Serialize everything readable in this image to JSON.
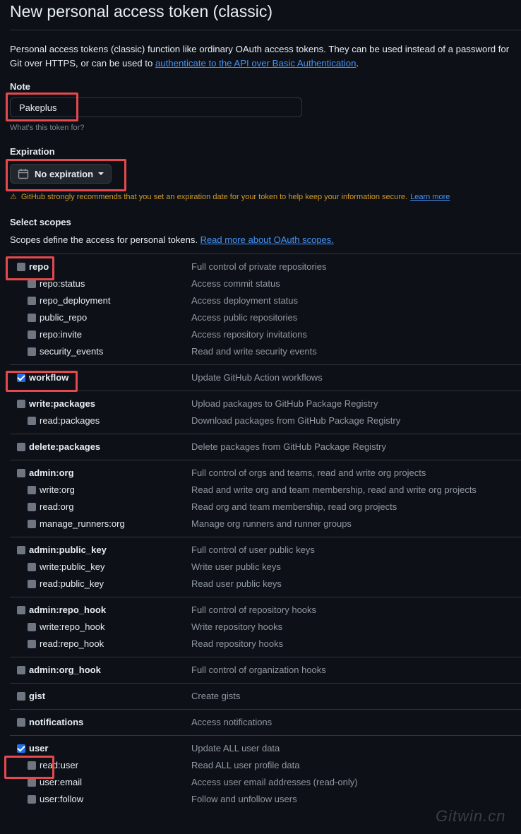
{
  "page": {
    "title": "New personal access token (classic)",
    "description_text": "Personal access tokens (classic) function like ordinary OAuth access tokens. They can be used instead of a password for Git over HTTPS, or can be used to",
    "description_link": "authenticate to the API over Basic Authentication",
    "description_end": "."
  },
  "note": {
    "label": "Note",
    "value": "Pakeplus",
    "hint": "What's this token for?"
  },
  "expiration": {
    "label": "Expiration",
    "selected": "No expiration",
    "warning": "GitHub strongly recommends that you set an expiration date for your token to help keep your information secure.",
    "learn_more": "Learn more"
  },
  "scopes": {
    "title": "Select scopes",
    "description": "Scopes define the access for personal tokens.",
    "link": "Read more about OAuth scopes.",
    "groups": [
      {
        "parent": {
          "name": "repo",
          "desc": "Full control of private repositories",
          "checked": false
        },
        "children": [
          {
            "name": "repo:status",
            "desc": "Access commit status",
            "checked": false
          },
          {
            "name": "repo_deployment",
            "desc": "Access deployment status",
            "checked": false
          },
          {
            "name": "public_repo",
            "desc": "Access public repositories",
            "checked": false
          },
          {
            "name": "repo:invite",
            "desc": "Access repository invitations",
            "checked": false
          },
          {
            "name": "security_events",
            "desc": "Read and write security events",
            "checked": false
          }
        ]
      },
      {
        "parent": {
          "name": "workflow",
          "desc": "Update GitHub Action workflows",
          "checked": true
        },
        "children": []
      },
      {
        "parent": {
          "name": "write:packages",
          "desc": "Upload packages to GitHub Package Registry",
          "checked": false
        },
        "children": [
          {
            "name": "read:packages",
            "desc": "Download packages from GitHub Package Registry",
            "checked": false
          }
        ]
      },
      {
        "parent": {
          "name": "delete:packages",
          "desc": "Delete packages from GitHub Package Registry",
          "checked": false
        },
        "children": []
      },
      {
        "parent": {
          "name": "admin:org",
          "desc": "Full control of orgs and teams, read and write org projects",
          "checked": false
        },
        "children": [
          {
            "name": "write:org",
            "desc": "Read and write org and team membership, read and write org projects",
            "checked": false
          },
          {
            "name": "read:org",
            "desc": "Read org and team membership, read org projects",
            "checked": false
          },
          {
            "name": "manage_runners:org",
            "desc": "Manage org runners and runner groups",
            "checked": false
          }
        ]
      },
      {
        "parent": {
          "name": "admin:public_key",
          "desc": "Full control of user public keys",
          "checked": false
        },
        "children": [
          {
            "name": "write:public_key",
            "desc": "Write user public keys",
            "checked": false
          },
          {
            "name": "read:public_key",
            "desc": "Read user public keys",
            "checked": false
          }
        ]
      },
      {
        "parent": {
          "name": "admin:repo_hook",
          "desc": "Full control of repository hooks",
          "checked": false
        },
        "children": [
          {
            "name": "write:repo_hook",
            "desc": "Write repository hooks",
            "checked": false
          },
          {
            "name": "read:repo_hook",
            "desc": "Read repository hooks",
            "checked": false
          }
        ]
      },
      {
        "parent": {
          "name": "admin:org_hook",
          "desc": "Full control of organization hooks",
          "checked": false
        },
        "children": []
      },
      {
        "parent": {
          "name": "gist",
          "desc": "Create gists",
          "checked": false
        },
        "children": []
      },
      {
        "parent": {
          "name": "notifications",
          "desc": "Access notifications",
          "checked": false
        },
        "children": []
      },
      {
        "parent": {
          "name": "user",
          "desc": "Update ALL user data",
          "checked": true
        },
        "children": [
          {
            "name": "read:user",
            "desc": "Read ALL user profile data",
            "checked": false
          },
          {
            "name": "user:email",
            "desc": "Access user email addresses (read-only)",
            "checked": false
          },
          {
            "name": "user:follow",
            "desc": "Follow and unfollow users",
            "checked": false
          }
        ]
      }
    ]
  },
  "watermark": "Gitwin.cn",
  "colors": {
    "background": "#0d1117",
    "link": "#4493f8",
    "warning": "#d29922",
    "checkbox_checked": "#1f6feb",
    "highlight": "#e5484d"
  }
}
